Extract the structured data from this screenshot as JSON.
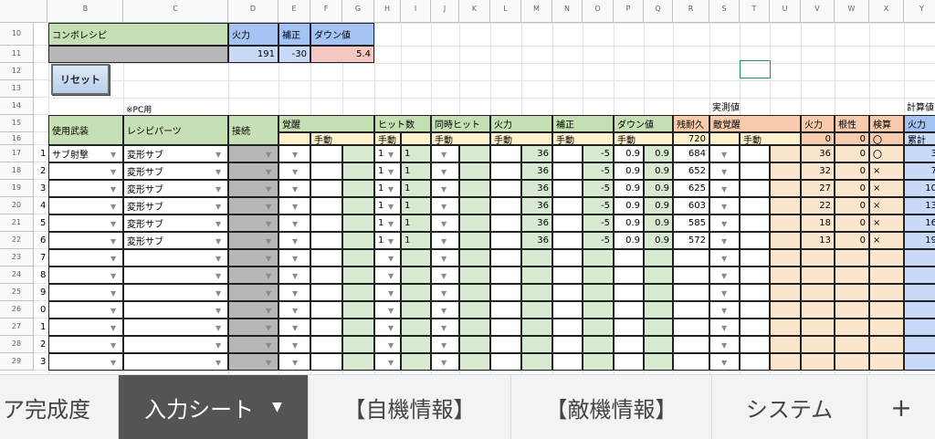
{
  "columns": [
    "B",
    "C",
    "D",
    "E",
    "F",
    "G",
    "H",
    "I",
    "J",
    "K",
    "L",
    "M",
    "N",
    "O",
    "P",
    "Q",
    "R",
    "S",
    "T",
    "U",
    "V",
    "W",
    "X",
    "Y"
  ],
  "row_numbers": [
    "10",
    "11",
    "12",
    "13",
    "14",
    "15",
    "16",
    "17",
    "18",
    "19",
    "20",
    "21",
    "22",
    "23",
    "24",
    "25",
    "26",
    "27",
    "28",
    "29"
  ],
  "row_indices": [
    "1",
    "2",
    "3",
    "4",
    "5",
    "6",
    "7",
    "8",
    "9",
    "0",
    "1",
    "2",
    "3"
  ],
  "combo": {
    "label": "コンボレシピ",
    "power_label": "火力",
    "correction_label": "補正",
    "down_label": "ダウン値",
    "power": "191",
    "correction": "-30",
    "down": "5.4"
  },
  "reset_label": "リセット",
  "pc_note": "※PC用",
  "measured_label": "実測値",
  "calc_label": "計算値",
  "headers": {
    "weapon": "使用武装",
    "parts": "レシピパーツ",
    "connect": "接続",
    "awaken": "覚醒",
    "hits": "ヒット数",
    "simul": "同時ヒット",
    "power": "火力",
    "correction": "補正",
    "down": "ダウン値",
    "remaining": "残耐久",
    "enemy_awaken": "敵覚醒",
    "c_power": "火力",
    "guts": "根性",
    "check": "検算",
    "c2_power": "火力",
    "manual": "手動",
    "manual2": "手動",
    "manual3": "手動",
    "manual4": "手動",
    "manual5": "手動",
    "manual6": "手動",
    "manual7": "手動",
    "c_power_sub": "0",
    "guts_sub": "0",
    "check_sub": "〇",
    "cum": "累計"
  },
  "rows": [
    {
      "weapon": "サブ射撃",
      "part": "変形サブ",
      "hits": "1",
      "hits2": "1",
      "power": "36",
      "correction": "-5",
      "down1": "0.9",
      "down2": "0.9",
      "remaining": "684",
      "c_power": "36",
      "guts": "0",
      "check": "〇",
      "y": "3"
    },
    {
      "weapon": "",
      "part": "変形サブ",
      "hits": "1",
      "hits2": "1",
      "power": "36",
      "correction": "-5",
      "down1": "0.9",
      "down2": "0.9",
      "remaining": "652",
      "c_power": "32",
      "guts": "0",
      "check": "×",
      "y": "7"
    },
    {
      "weapon": "",
      "part": "変形サブ",
      "hits": "1",
      "hits2": "1",
      "power": "36",
      "correction": "-5",
      "down1": "0.9",
      "down2": "0.9",
      "remaining": "625",
      "c_power": "27",
      "guts": "0",
      "check": "×",
      "y": "10"
    },
    {
      "weapon": "",
      "part": "変形サブ",
      "hits": "1",
      "hits2": "1",
      "power": "36",
      "correction": "-5",
      "down1": "0.9",
      "down2": "0.9",
      "remaining": "603",
      "c_power": "22",
      "guts": "0",
      "check": "×",
      "y": "13"
    },
    {
      "weapon": "",
      "part": "変形サブ",
      "hits": "1",
      "hits2": "1",
      "power": "36",
      "correction": "-5",
      "down1": "0.9",
      "down2": "0.9",
      "remaining": "585",
      "c_power": "18",
      "guts": "0",
      "check": "×",
      "y": "16"
    },
    {
      "weapon": "",
      "part": "変形サブ",
      "hits": "1",
      "hits2": "1",
      "power": "36",
      "correction": "-5",
      "down1": "0.9",
      "down2": "0.9",
      "remaining": "572",
      "c_power": "13",
      "guts": "0",
      "check": "×",
      "y": "19"
    }
  ],
  "remaining_initial": "720",
  "tabs": {
    "t0": "ア完成度",
    "t1": "入力シート",
    "t2": "【自機情報】",
    "t3": "【敵機情報】",
    "t4": "システム",
    "add": "+"
  },
  "colors": {
    "green": "#c6dfb4",
    "green_light": "#d9ead3",
    "blue": "#a4c2f4",
    "blue_light": "#c9daf8",
    "orange": "#f8cbad",
    "orange_light": "#fce5cd",
    "pink": "#f4c7c3",
    "gray": "#b7b7b7",
    "yellow": "#fff2cc"
  }
}
